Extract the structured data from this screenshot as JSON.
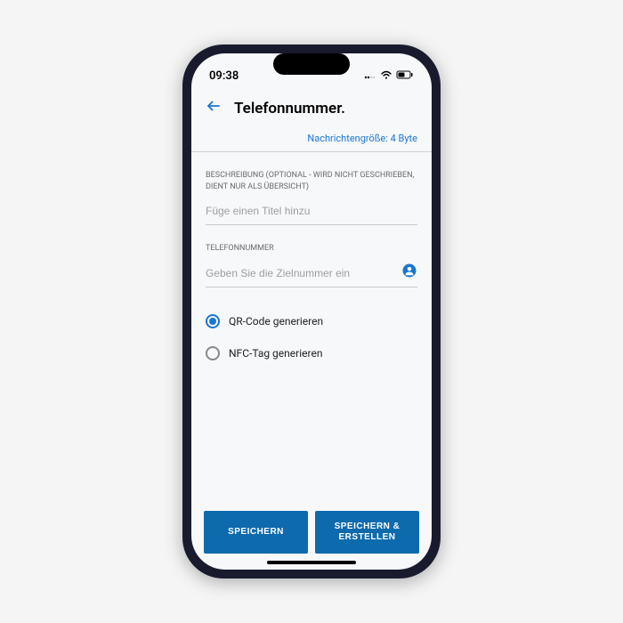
{
  "status": {
    "time": "09:38",
    "signal": "●●○○",
    "wifi": "wifi",
    "battery": "battery"
  },
  "header": {
    "title": "Telefonnummer."
  },
  "message_size": "Nachrichtengröße: 4 Byte",
  "description": {
    "label": "BESCHREIBUNG (OPTIONAL - Wird nicht geschrieben, dient nur als Übersicht)",
    "placeholder": "Füge einen Titel hinzu"
  },
  "phone": {
    "label": "TELEFONNUMMER",
    "placeholder": "Geben Sie die Zielnummer ein"
  },
  "options": {
    "qr": "QR-Code generieren",
    "nfc": "NFC-Tag generieren",
    "selected": "qr"
  },
  "buttons": {
    "save": "SPEICHERN",
    "save_create": "SPEICHERN & ERSTELLEN"
  }
}
